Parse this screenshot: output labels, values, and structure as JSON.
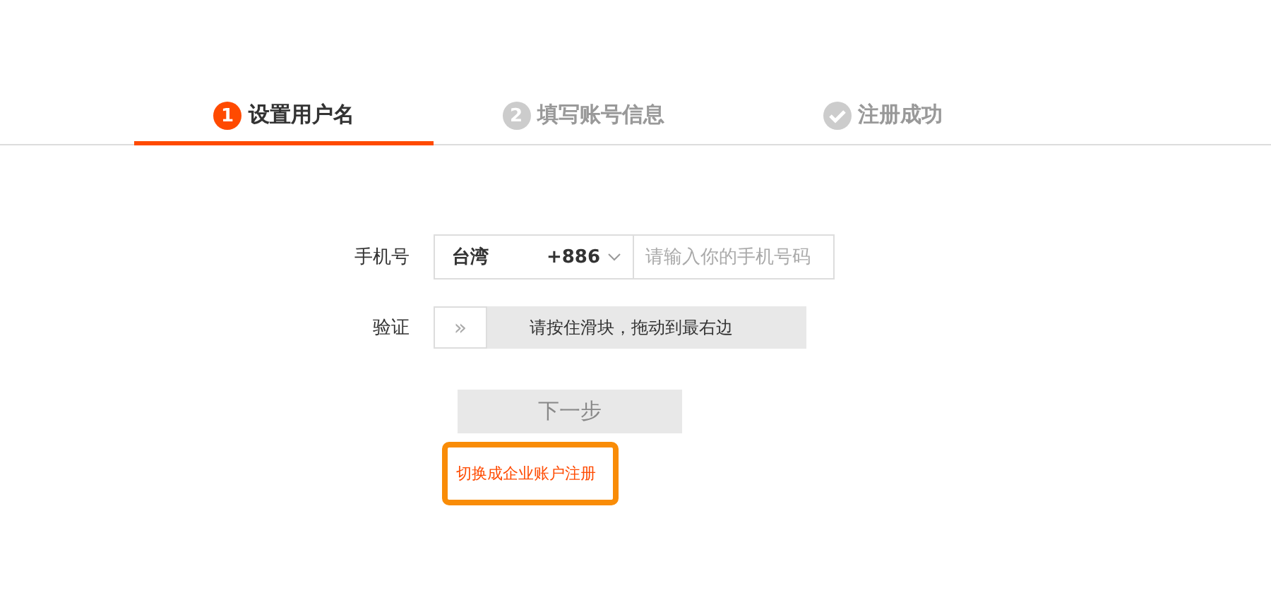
{
  "steps": [
    {
      "kind": "number",
      "marker": "1",
      "label": "设置用户名",
      "selected": true
    },
    {
      "kind": "number",
      "marker": "2",
      "label": "填写账号信息",
      "selected": false
    },
    {
      "kind": "check",
      "label": "注册成功",
      "selected": false
    }
  ],
  "form": {
    "phone_label": "手机号",
    "country": "台湾",
    "country_code": "+886",
    "phone_placeholder": "请输入你的手机号码",
    "verify_label": "验证",
    "slider_handle": "»",
    "slider_hint": "请按住滑块，拖动到最右边",
    "next_button": "下一步",
    "next_disabled": true,
    "switch_link": "切换成企业账户注册",
    "switch_highlighted": true
  }
}
